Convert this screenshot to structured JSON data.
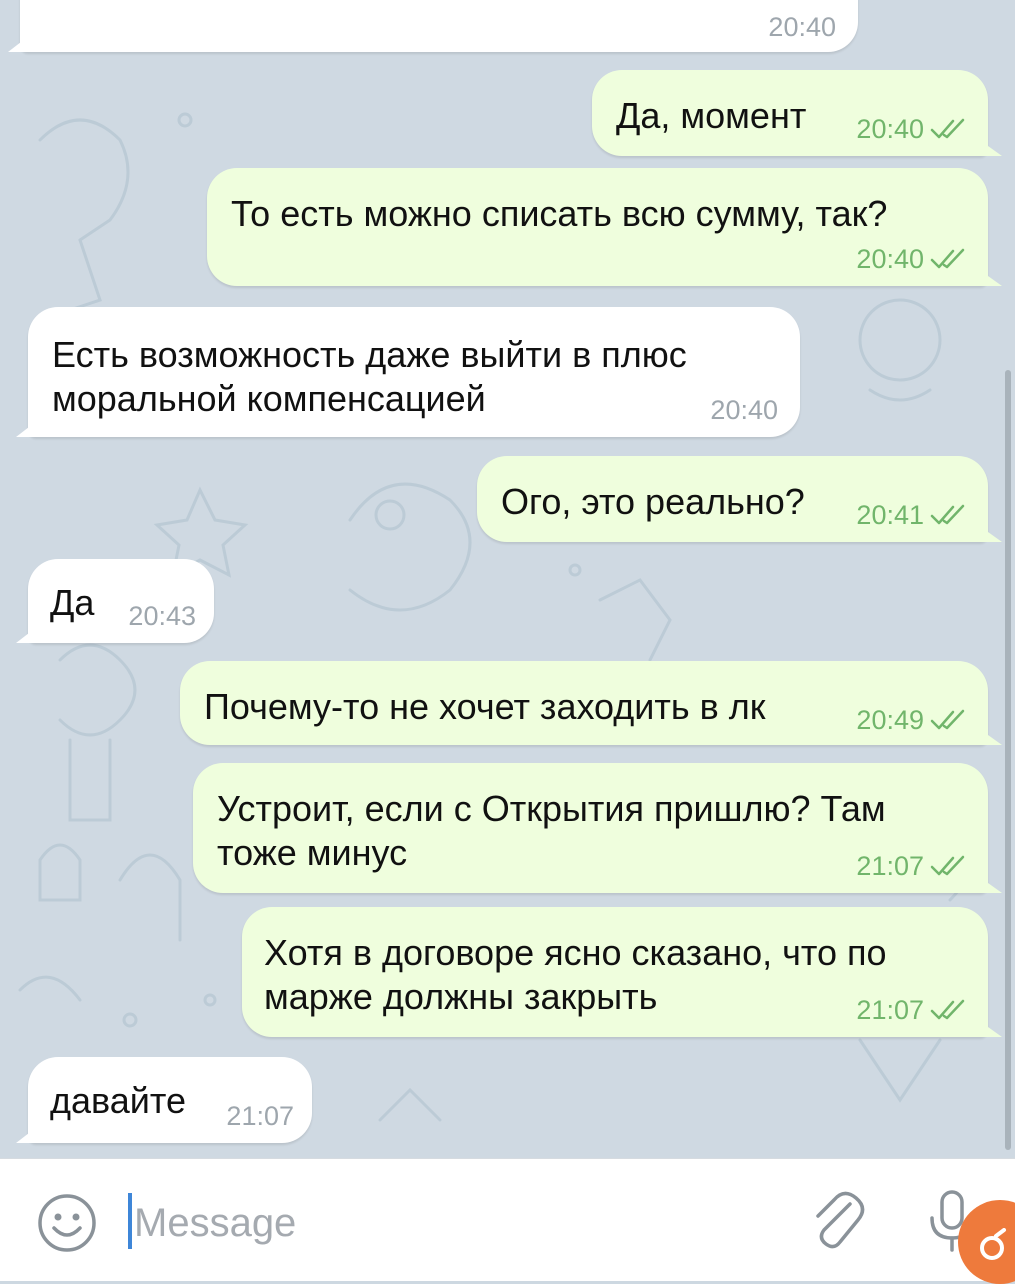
{
  "messages": [
    {
      "dir": "in",
      "text": "",
      "time": "20:40"
    },
    {
      "dir": "out",
      "text": "Да, момент",
      "time": "20:40",
      "status": "read"
    },
    {
      "dir": "out",
      "text": "То есть можно списать всю сумму, так?",
      "time": "20:40",
      "status": "read"
    },
    {
      "dir": "in",
      "text": "Есть возможность даже выйти в плюс\nморальной компенсацией",
      "time": "20:40"
    },
    {
      "dir": "out",
      "text": "Ого, это реально?",
      "time": "20:41",
      "status": "read"
    },
    {
      "dir": "in",
      "text": "Да",
      "time": "20:43"
    },
    {
      "dir": "out",
      "text": "Почему-то не хочет заходить в лк",
      "time": "20:49",
      "status": "read"
    },
    {
      "dir": "out",
      "text": "Устроит, если с Открытия пришлю? Там\nтоже минус",
      "time": "21:07",
      "status": "read"
    },
    {
      "dir": "out",
      "text": "Хотя в договоре ясно сказано, что по\nмарже должны закрыть",
      "time": "21:07",
      "status": "read"
    },
    {
      "dir": "in",
      "text": "давайте",
      "time": "21:07"
    }
  ],
  "composer": {
    "placeholder": "Message",
    "value": ""
  },
  "icons": {
    "emoji": "smile-icon",
    "attach": "paperclip-icon",
    "voice": "microphone-icon",
    "read_status": "double-check-icon"
  },
  "colors": {
    "chat_background": "#cfd9e2",
    "incoming_bubble": "#ffffff",
    "outgoing_bubble": "#effedd",
    "outgoing_meta": "#71b56b",
    "incoming_meta": "#9ea6ad",
    "caret": "#3e86d8"
  }
}
